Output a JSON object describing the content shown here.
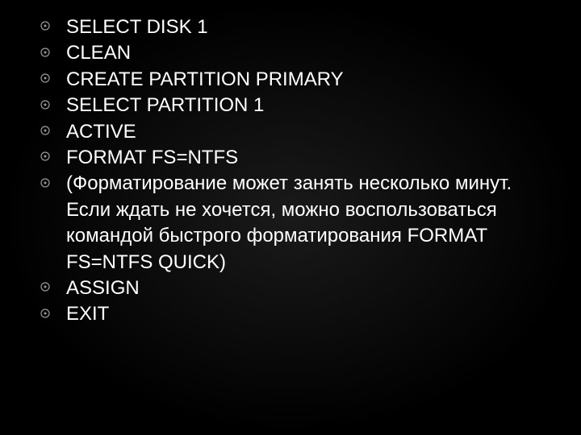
{
  "items": [
    "SELECT DISK 1",
    "CLEAN",
    "CREATE PARTITION PRIMARY",
    "SELECT PARTITION 1",
    "ACTIVE",
    "FORMAT FS=NTFS",
    " (Форматирование может занять несколько минут. Если ждать не хочется, можно воспользоваться командой быстрого форматирования FORMAT FS=NTFS QUICK)",
    "ASSIGN",
    "EXIT"
  ]
}
